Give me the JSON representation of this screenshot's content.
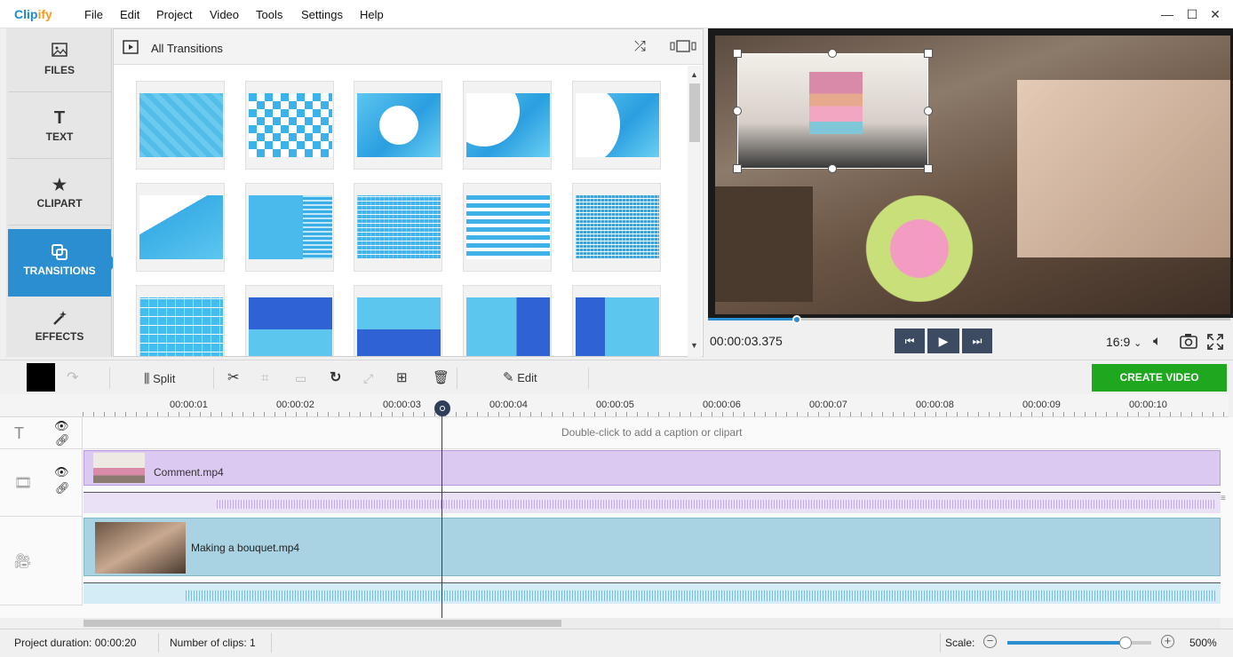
{
  "app": {
    "logo_main": "Clip",
    "logo_accent": "ify"
  },
  "menu": [
    "File",
    "Edit",
    "Project",
    "Video",
    "Tools",
    "Settings",
    "Help"
  ],
  "sidebar": {
    "items": [
      {
        "label": "FILES",
        "icon": "image-icon"
      },
      {
        "label": "TEXT",
        "icon": "text-icon"
      },
      {
        "label": "CLIPART",
        "icon": "star-icon"
      },
      {
        "label": "TRANSITIONS",
        "icon": "transitions-icon",
        "active": true
      },
      {
        "label": "EFFECTS",
        "icon": "magic-wand-icon"
      }
    ]
  },
  "transitions": {
    "title": "All Transitions"
  },
  "preview": {
    "timecode": "00:00:03.375",
    "aspect": "16:9",
    "aspect_chevron": "⌄"
  },
  "toolbar": {
    "split_label": "Split",
    "edit_label": "Edit",
    "create_label": "CREATE VIDEO"
  },
  "ruler": [
    "00:00:01",
    "00:00:02",
    "00:00:03",
    "00:00:04",
    "00:00:05",
    "00:00:06",
    "00:00:07",
    "00:00:08",
    "00:00:09",
    "00:00:10"
  ],
  "tracks": {
    "caption_hint": "Double-click to add a caption or clipart",
    "clip1": "Comment.mp4",
    "clip2": "Making a bouquet.mp4"
  },
  "status": {
    "duration_label": "Project duration:",
    "duration_value": "00:00:20",
    "clips_label": "Number of clips:",
    "clips_value": "1",
    "scale_label": "Scale:",
    "scale_value": "500%",
    "scale_level": 0.82
  },
  "colors": {
    "accent": "#2b8ed1",
    "create": "#1fa71f",
    "overlay_track": "#dcc9f1",
    "main_track": "#a9d3e3"
  }
}
